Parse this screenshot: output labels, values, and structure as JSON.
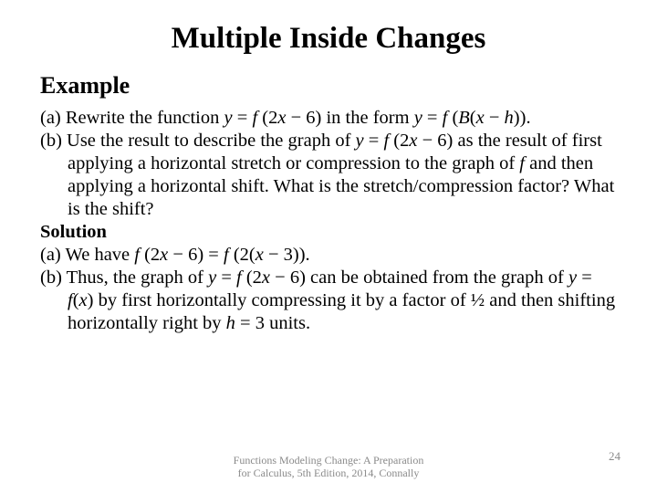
{
  "title": "Multiple Inside Changes",
  "subheading": "Example",
  "paraA_lead": "(a) Rewrite the function ",
  "paraA_y1": "y",
  "paraA_eq1": " = ",
  "paraA_f1": "f ",
  "paraA_arg1a": "(2",
  "paraA_x1": "x",
  "paraA_arg1b": " − 6) in the form ",
  "paraA_y2": "y",
  "paraA_eq2": " = ",
  "paraA_f2": "f ",
  "paraA_arg2a": "(",
  "paraA_B": "B",
  "paraA_arg2b": "(",
  "paraA_x2": "x",
  "paraA_arg2c": " − ",
  "paraA_h": "h",
  "paraA_arg2d": ")).",
  "paraB_lead": "(b) Use the result to describe the graph of ",
  "paraB_y": "y",
  "paraB_eq": " = ",
  "paraB_f": "f ",
  "paraB_arg_a": "(2",
  "paraB_x": "x",
  "paraB_arg_b": " − 6) as the result of first applying a horizontal stretch or compression to the graph of ",
  "paraB_f2": "f",
  "paraB_tail": " and then applying a horizontal shift. What is the stretch/compression factor? What is the shift?",
  "solution_label": "Solution",
  "ansA_lead": "(a) We have ",
  "ansA_f1": "f ",
  "ansA_a": "(2",
  "ansA_x1": "x",
  "ansA_b": " − 6) = ",
  "ansA_f2": "f ",
  "ansA_c": "(2(",
  "ansA_x2": "x",
  "ansA_d": " − 3)).",
  "ansB_lead": "(b) Thus, the graph of ",
  "ansB_y1": "y",
  "ansB_eq1": " = ",
  "ansB_f1": "f ",
  "ansB_a": "(2",
  "ansB_x1": "x",
  "ansB_b": " − 6) can be obtained from the graph of ",
  "ansB_y2": "y",
  "ansB_eq2": " = ",
  "ansB_f2": "f",
  "ansB_c": "(",
  "ansB_x2": "x",
  "ansB_d": ") by first horizontally compressing it by a factor of ½ and then shifting horizontally right by ",
  "ansB_h": "h",
  "ansB_e": " = 3 units.",
  "footer_line1": "Functions Modeling Change: A Preparation",
  "footer_line2": "for Calculus, 5th Edition, 2014, Connally",
  "page_number": "24"
}
